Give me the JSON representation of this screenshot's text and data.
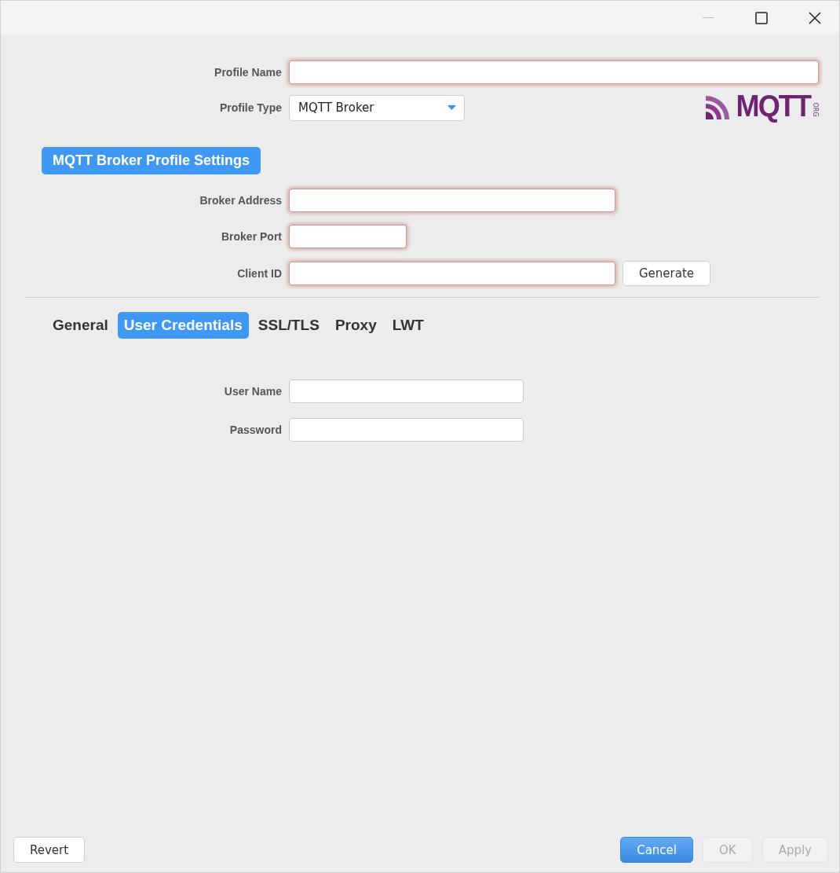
{
  "profile": {
    "fields": [
      {
        "label": "Profile Name",
        "kind": "text",
        "invalid": true
      },
      {
        "label": "Profile Type",
        "kind": "select",
        "value": "MQTT Broker",
        "invalid": false
      }
    ],
    "logo": {
      "text": "MQTT",
      "suffix": "ORG"
    }
  },
  "section": {
    "title": "MQTT Broker Profile Settings"
  },
  "broker_fields": [
    {
      "label": "Broker Address",
      "invalid": true
    },
    {
      "label": "Broker Port",
      "invalid": true
    },
    {
      "label": "Client ID",
      "invalid": true,
      "button": "Generate"
    }
  ],
  "tabs": [
    {
      "label": "General",
      "selected": false
    },
    {
      "label": "User Credentials",
      "selected": true
    },
    {
      "label": "SSL/TLS",
      "selected": false
    },
    {
      "label": "Proxy",
      "selected": false
    },
    {
      "label": "LWT",
      "selected": false
    }
  ],
  "credential_fields": [
    {
      "label": "User Name",
      "invalid": false
    },
    {
      "label": "Password",
      "invalid": false
    }
  ],
  "footer": {
    "left": [
      {
        "label": "Revert",
        "kind": "normal",
        "disabled": false
      }
    ],
    "right": [
      {
        "label": "Cancel",
        "kind": "primary",
        "disabled": false
      },
      {
        "label": "OK",
        "kind": "normal",
        "disabled": true
      },
      {
        "label": "Apply",
        "kind": "normal",
        "disabled": true
      }
    ]
  }
}
